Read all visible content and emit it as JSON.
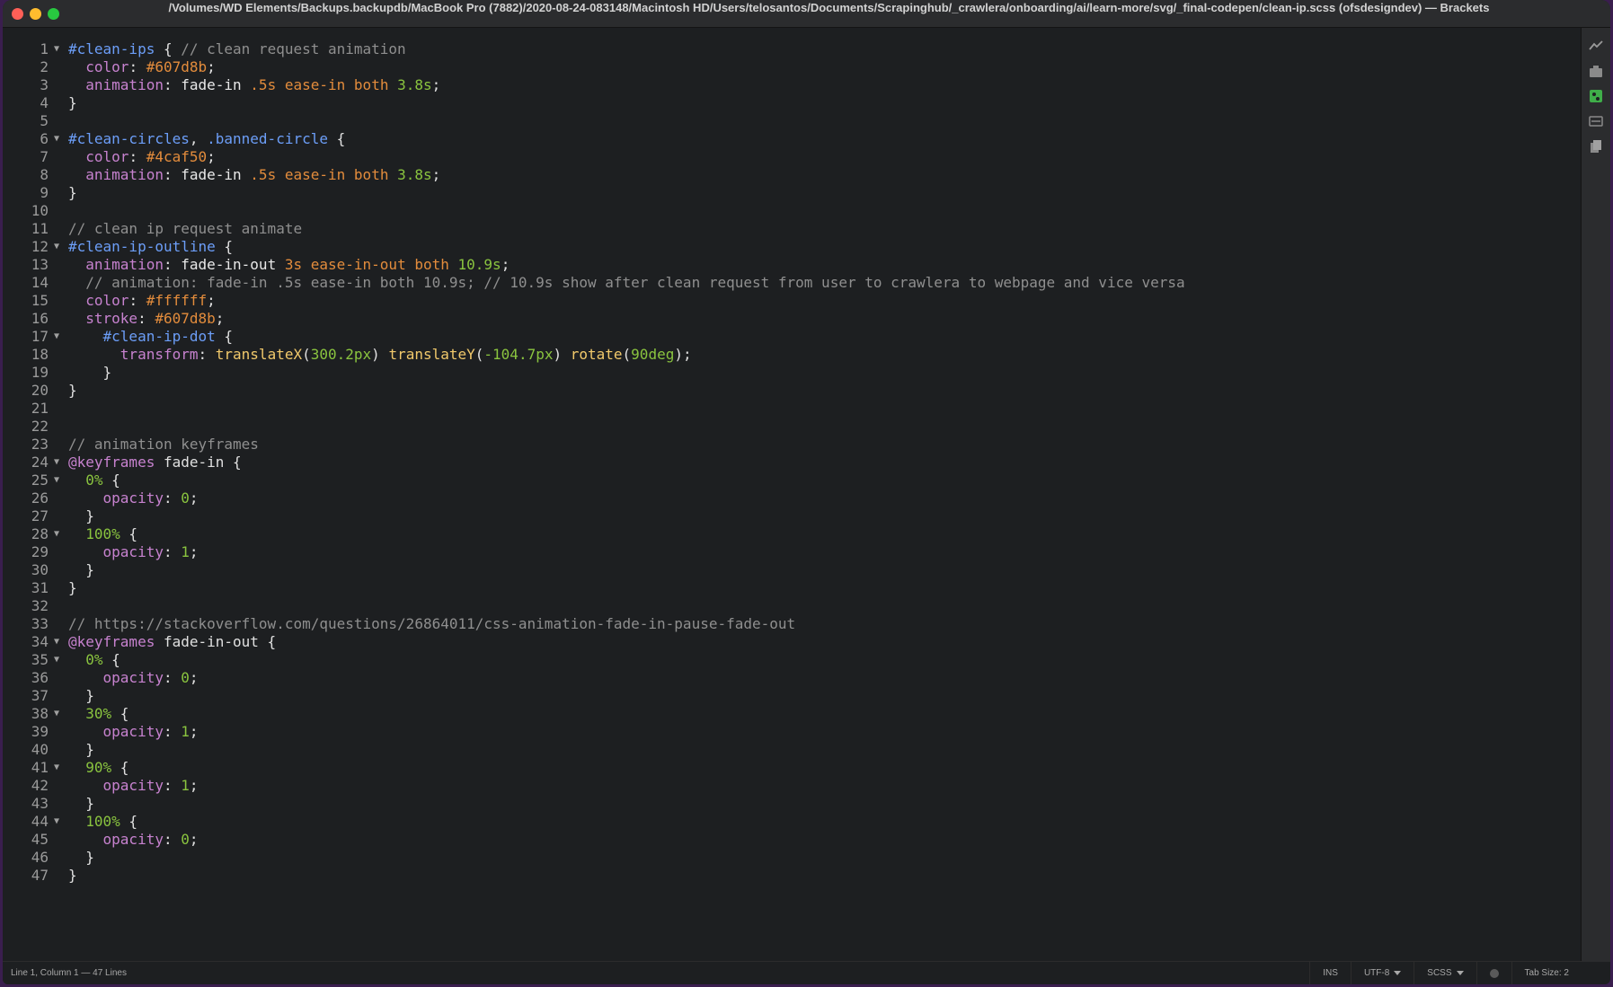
{
  "window": {
    "title": "/Volumes/WD Elements/Backups.backupdb/MacBook Pro (7882)/2020-08-24-083148/Macintosh HD/Users/telosantos/Documents/Scrapinghub/_crawlera/onboarding/ai/learn-more/svg/_final-codepen/clean-ip.scss (ofsdesigndev) — Brackets"
  },
  "editor": {
    "lines": [
      {
        "n": "1",
        "fold": true,
        "tokens": [
          [
            "sel",
            "#clean-ips"
          ],
          [
            "p",
            " { "
          ],
          [
            "cmt",
            "// clean request animation"
          ]
        ]
      },
      {
        "n": "2",
        "fold": false,
        "tokens": [
          [
            "p",
            "  "
          ],
          [
            "prop",
            "color"
          ],
          [
            "p",
            ": "
          ],
          [
            "hex",
            "#607d8b"
          ],
          [
            "p",
            ";"
          ]
        ]
      },
      {
        "n": "3",
        "fold": false,
        "tokens": [
          [
            "p",
            "  "
          ],
          [
            "prop",
            "animation"
          ],
          [
            "p",
            ": "
          ],
          [
            "val",
            "fade-in "
          ],
          [
            "hex",
            ".5s"
          ],
          [
            "p",
            " "
          ],
          [
            "kw",
            "ease-in"
          ],
          [
            "p",
            " "
          ],
          [
            "kw",
            "both"
          ],
          [
            "p",
            " "
          ],
          [
            "num",
            "3.8s"
          ],
          [
            "p",
            ";"
          ]
        ]
      },
      {
        "n": "4",
        "fold": false,
        "tokens": [
          [
            "p",
            "}"
          ]
        ]
      },
      {
        "n": "5",
        "fold": false,
        "tokens": []
      },
      {
        "n": "6",
        "fold": true,
        "tokens": [
          [
            "sel",
            "#clean-circles"
          ],
          [
            "p",
            ", "
          ],
          [
            "sel",
            ".banned-circle"
          ],
          [
            "p",
            " {"
          ]
        ]
      },
      {
        "n": "7",
        "fold": false,
        "tokens": [
          [
            "p",
            "  "
          ],
          [
            "prop",
            "color"
          ],
          [
            "p",
            ": "
          ],
          [
            "hex",
            "#4caf50"
          ],
          [
            "p",
            ";"
          ]
        ]
      },
      {
        "n": "8",
        "fold": false,
        "tokens": [
          [
            "p",
            "  "
          ],
          [
            "prop",
            "animation"
          ],
          [
            "p",
            ": "
          ],
          [
            "val",
            "fade-in "
          ],
          [
            "hex",
            ".5s"
          ],
          [
            "p",
            " "
          ],
          [
            "kw",
            "ease-in"
          ],
          [
            "p",
            " "
          ],
          [
            "kw",
            "both"
          ],
          [
            "p",
            " "
          ],
          [
            "num",
            "3.8s"
          ],
          [
            "p",
            ";"
          ]
        ]
      },
      {
        "n": "9",
        "fold": false,
        "tokens": [
          [
            "p",
            "}"
          ]
        ]
      },
      {
        "n": "10",
        "fold": false,
        "tokens": []
      },
      {
        "n": "11",
        "fold": false,
        "tokens": [
          [
            "cmt",
            "// clean ip request animate"
          ]
        ]
      },
      {
        "n": "12",
        "fold": true,
        "tokens": [
          [
            "sel",
            "#clean-ip-outline"
          ],
          [
            "p",
            " {"
          ]
        ]
      },
      {
        "n": "13",
        "fold": false,
        "tokens": [
          [
            "p",
            "  "
          ],
          [
            "prop",
            "animation"
          ],
          [
            "p",
            ": "
          ],
          [
            "val",
            "fade-in-out "
          ],
          [
            "hex",
            "3s"
          ],
          [
            "p",
            " "
          ],
          [
            "kw",
            "ease-in-out"
          ],
          [
            "p",
            " "
          ],
          [
            "kw",
            "both"
          ],
          [
            "p",
            " "
          ],
          [
            "num",
            "10.9s"
          ],
          [
            "p",
            ";"
          ]
        ]
      },
      {
        "n": "14",
        "fold": false,
        "tokens": [
          [
            "p",
            "  "
          ],
          [
            "cmt",
            "// animation: fade-in .5s ease-in both 10.9s; // 10.9s show after clean request from user to crawlera to webpage and vice versa"
          ]
        ]
      },
      {
        "n": "15",
        "fold": false,
        "tokens": [
          [
            "p",
            "  "
          ],
          [
            "prop",
            "color"
          ],
          [
            "p",
            ": "
          ],
          [
            "hex",
            "#ffffff"
          ],
          [
            "p",
            ";"
          ]
        ]
      },
      {
        "n": "16",
        "fold": false,
        "tokens": [
          [
            "p",
            "  "
          ],
          [
            "prop",
            "stroke"
          ],
          [
            "p",
            ": "
          ],
          [
            "hex",
            "#607d8b"
          ],
          [
            "p",
            ";"
          ]
        ]
      },
      {
        "n": "17",
        "fold": true,
        "tokens": [
          [
            "p",
            "    "
          ],
          [
            "sel",
            "#clean-ip-dot"
          ],
          [
            "p",
            " {"
          ]
        ]
      },
      {
        "n": "18",
        "fold": false,
        "tokens": [
          [
            "p",
            "      "
          ],
          [
            "prop",
            "transform"
          ],
          [
            "p",
            ": "
          ],
          [
            "fn",
            "translateX"
          ],
          [
            "p",
            "("
          ],
          [
            "num",
            "300.2px"
          ],
          [
            "p",
            ") "
          ],
          [
            "fn",
            "translateY"
          ],
          [
            "p",
            "("
          ],
          [
            "num",
            "-104.7px"
          ],
          [
            "p",
            ") "
          ],
          [
            "fn",
            "rotate"
          ],
          [
            "p",
            "("
          ],
          [
            "num",
            "90deg"
          ],
          [
            "p",
            ");"
          ]
        ]
      },
      {
        "n": "19",
        "fold": false,
        "tokens": [
          [
            "p",
            "    }"
          ]
        ]
      },
      {
        "n": "20",
        "fold": false,
        "tokens": [
          [
            "p",
            "}"
          ]
        ]
      },
      {
        "n": "21",
        "fold": false,
        "tokens": []
      },
      {
        "n": "22",
        "fold": false,
        "tokens": []
      },
      {
        "n": "23",
        "fold": false,
        "tokens": [
          [
            "cmt",
            "// animation keyframes"
          ]
        ]
      },
      {
        "n": "24",
        "fold": true,
        "tokens": [
          [
            "at",
            "@keyframes"
          ],
          [
            "p",
            " fade-in {"
          ]
        ]
      },
      {
        "n": "25",
        "fold": true,
        "tokens": [
          [
            "p",
            "  "
          ],
          [
            "pct",
            "0%"
          ],
          [
            "p",
            " {"
          ]
        ]
      },
      {
        "n": "26",
        "fold": false,
        "tokens": [
          [
            "p",
            "    "
          ],
          [
            "prop",
            "opacity"
          ],
          [
            "p",
            ": "
          ],
          [
            "num",
            "0"
          ],
          [
            "p",
            ";"
          ]
        ]
      },
      {
        "n": "27",
        "fold": false,
        "tokens": [
          [
            "p",
            "  }"
          ]
        ]
      },
      {
        "n": "28",
        "fold": true,
        "tokens": [
          [
            "p",
            "  "
          ],
          [
            "pct",
            "100%"
          ],
          [
            "p",
            " {"
          ]
        ]
      },
      {
        "n": "29",
        "fold": false,
        "tokens": [
          [
            "p",
            "    "
          ],
          [
            "prop",
            "opacity"
          ],
          [
            "p",
            ": "
          ],
          [
            "num",
            "1"
          ],
          [
            "p",
            ";"
          ]
        ]
      },
      {
        "n": "30",
        "fold": false,
        "tokens": [
          [
            "p",
            "  }"
          ]
        ]
      },
      {
        "n": "31",
        "fold": false,
        "tokens": [
          [
            "p",
            "}"
          ]
        ]
      },
      {
        "n": "32",
        "fold": false,
        "tokens": []
      },
      {
        "n": "33",
        "fold": false,
        "tokens": [
          [
            "cmt",
            "// https://stackoverflow.com/questions/26864011/css-animation-fade-in-pause-fade-out"
          ]
        ]
      },
      {
        "n": "34",
        "fold": true,
        "tokens": [
          [
            "at",
            "@keyframes"
          ],
          [
            "p",
            " fade-in-out {"
          ]
        ]
      },
      {
        "n": "35",
        "fold": true,
        "tokens": [
          [
            "p",
            "  "
          ],
          [
            "pct",
            "0%"
          ],
          [
            "p",
            " {"
          ]
        ]
      },
      {
        "n": "36",
        "fold": false,
        "tokens": [
          [
            "p",
            "    "
          ],
          [
            "prop",
            "opacity"
          ],
          [
            "p",
            ": "
          ],
          [
            "num",
            "0"
          ],
          [
            "p",
            ";"
          ]
        ]
      },
      {
        "n": "37",
        "fold": false,
        "tokens": [
          [
            "p",
            "  }"
          ]
        ]
      },
      {
        "n": "38",
        "fold": true,
        "tokens": [
          [
            "p",
            "  "
          ],
          [
            "pct",
            "30%"
          ],
          [
            "p",
            " {"
          ]
        ]
      },
      {
        "n": "39",
        "fold": false,
        "tokens": [
          [
            "p",
            "    "
          ],
          [
            "prop",
            "opacity"
          ],
          [
            "p",
            ": "
          ],
          [
            "num",
            "1"
          ],
          [
            "p",
            ";"
          ]
        ]
      },
      {
        "n": "40",
        "fold": false,
        "tokens": [
          [
            "p",
            "  }"
          ]
        ]
      },
      {
        "n": "41",
        "fold": true,
        "tokens": [
          [
            "p",
            "  "
          ],
          [
            "pct",
            "90%"
          ],
          [
            "p",
            " {"
          ]
        ]
      },
      {
        "n": "42",
        "fold": false,
        "tokens": [
          [
            "p",
            "    "
          ],
          [
            "prop",
            "opacity"
          ],
          [
            "p",
            ": "
          ],
          [
            "num",
            "1"
          ],
          [
            "p",
            ";"
          ]
        ]
      },
      {
        "n": "43",
        "fold": false,
        "tokens": [
          [
            "p",
            "  }"
          ]
        ]
      },
      {
        "n": "44",
        "fold": true,
        "tokens": [
          [
            "p",
            "  "
          ],
          [
            "pct",
            "100%"
          ],
          [
            "p",
            " {"
          ]
        ]
      },
      {
        "n": "45",
        "fold": false,
        "tokens": [
          [
            "p",
            "    "
          ],
          [
            "prop",
            "opacity"
          ],
          [
            "p",
            ": "
          ],
          [
            "num",
            "0"
          ],
          [
            "p",
            ";"
          ]
        ]
      },
      {
        "n": "46",
        "fold": false,
        "tokens": [
          [
            "p",
            "  }"
          ]
        ]
      },
      {
        "n": "47",
        "fold": false,
        "tokens": [
          [
            "p",
            "}"
          ]
        ]
      }
    ]
  },
  "right_toolbar": {
    "icons": [
      "live-preview-icon",
      "extension-manager-icon",
      "git-icon",
      "toolbar-panel-icon",
      "files-icon"
    ]
  },
  "status": {
    "position": "Line 1, Column 1 — 47 Lines",
    "mode": "INS",
    "encoding": "UTF-8",
    "language": "SCSS",
    "tab_size": "Tab Size: 2"
  }
}
